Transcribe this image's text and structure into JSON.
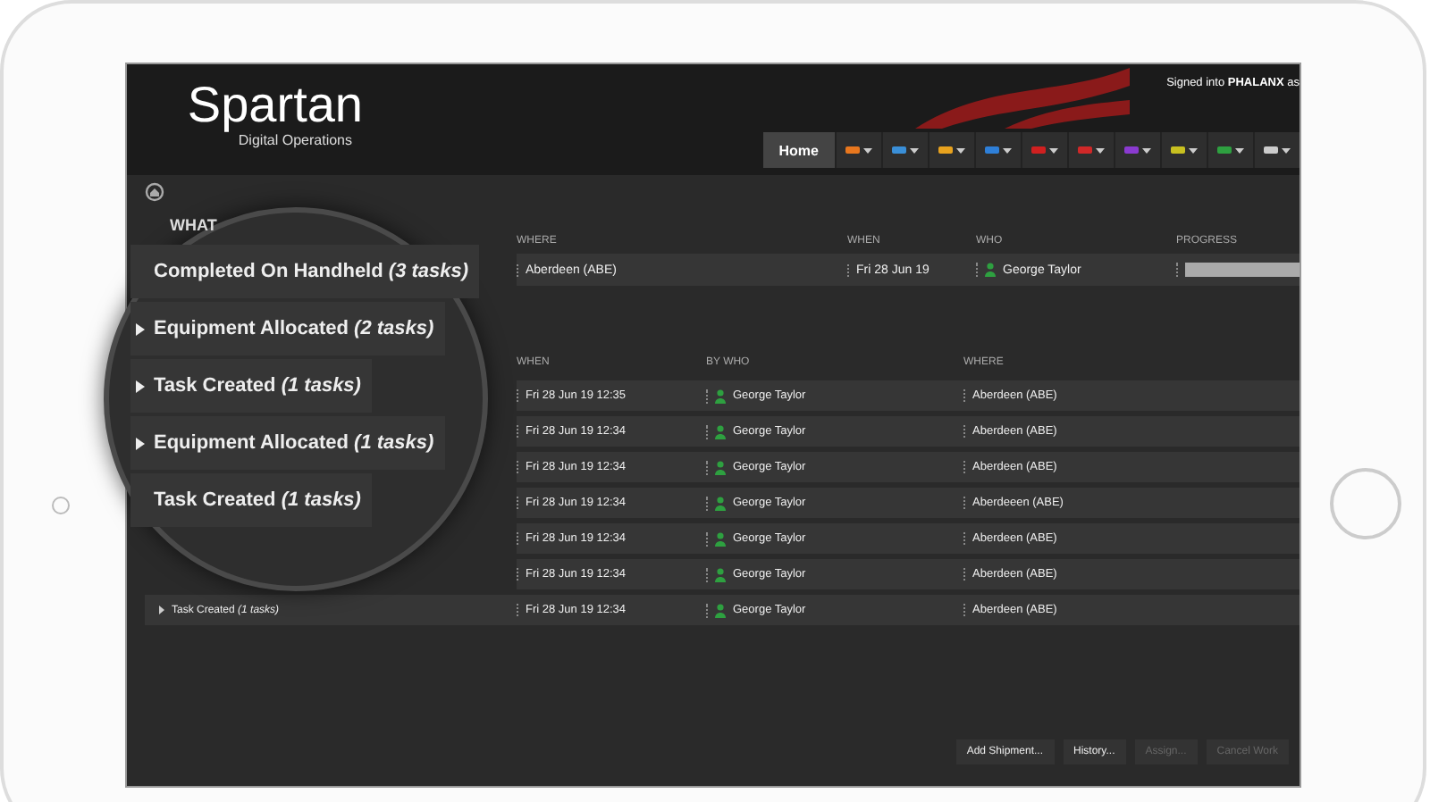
{
  "header": {
    "logo": "Spartan",
    "logo_subtitle": "Digital Operations",
    "signed_in": "Signed into **PHALANX** as"
  },
  "toolbar": {
    "home": "Home",
    "menus": [
      {
        "color": "#e8771e"
      },
      {
        "color": "#3a8fd8"
      },
      {
        "color": "#e8a21e"
      },
      {
        "color": "#2e7fd8"
      },
      {
        "color": "#d02020"
      },
      {
        "color": "#d02828"
      },
      {
        "color": "#8a3ad0"
      },
      {
        "color": "#c8c020"
      },
      {
        "color": "#2ea040"
      },
      {
        "color": "#cccccc"
      }
    ]
  },
  "summary": {
    "columns": [
      "WHERE",
      "WHEN",
      "WHO",
      "PROGRESS"
    ],
    "row": {
      "where": "Aberdeen (ABE)",
      "when": "Fri 28 Jun 19",
      "who": "George Taylor",
      "level": 1
    }
  },
  "magnifier": {
    "heading": "WHAT",
    "rows": [
      {
        "label": "Completed On Handheld *(3 tasks)*",
        "expandable": false
      },
      {
        "label": "Equipment Allocated *(2 tasks)*",
        "expandable": true
      },
      {
        "label": "Task Created *(1 tasks)*",
        "expandable": true
      },
      {
        "label": "Equipment Allocated *(1 tasks)*",
        "expandable": true
      },
      {
        "label": "Task Created *(1 tasks)*",
        "expandable": false
      }
    ]
  },
  "history": {
    "columns": [
      "WHEN",
      "BY WHO",
      "WHERE"
    ],
    "rows": [
      {
        "when": "Fri 28 Jun 19  12:35",
        "by_who": "George Taylor",
        "where": "Aberdeen (ABE)"
      },
      {
        "when": "Fri 28 Jun 19  12:34",
        "by_who": "George Taylor",
        "where": "Aberdeen (ABE)"
      },
      {
        "when": "Fri 28 Jun 19  12:34",
        "by_who": "George Taylor",
        "where": "Aberdeen (ABE)"
      },
      {
        "when": "Fri 28 Jun 19  12:34",
        "by_who": "George Taylor",
        "where": "Aberdeeen (ABE)"
      },
      {
        "when": "Fri 28 Jun 19  12:34",
        "by_who": "George Taylor",
        "where": "Aberdeen (ABE)"
      },
      {
        "when": "Fri 28 Jun 19  12:34",
        "by_who": "George Taylor",
        "where": "Aberdeen (ABE)"
      },
      {
        "what": "Task Created *(1 tasks)*",
        "when": "Fri 28 Jun 19  12:34",
        "by_who": "George Taylor",
        "where": "Aberdeen (ABE)"
      }
    ]
  },
  "buttons": [
    {
      "label": "Add Shipment...",
      "disabled": false
    },
    {
      "label": "History...",
      "disabled": false
    },
    {
      "label": "Assign...",
      "disabled": true
    },
    {
      "label": "Cancel Work",
      "disabled": true
    }
  ]
}
